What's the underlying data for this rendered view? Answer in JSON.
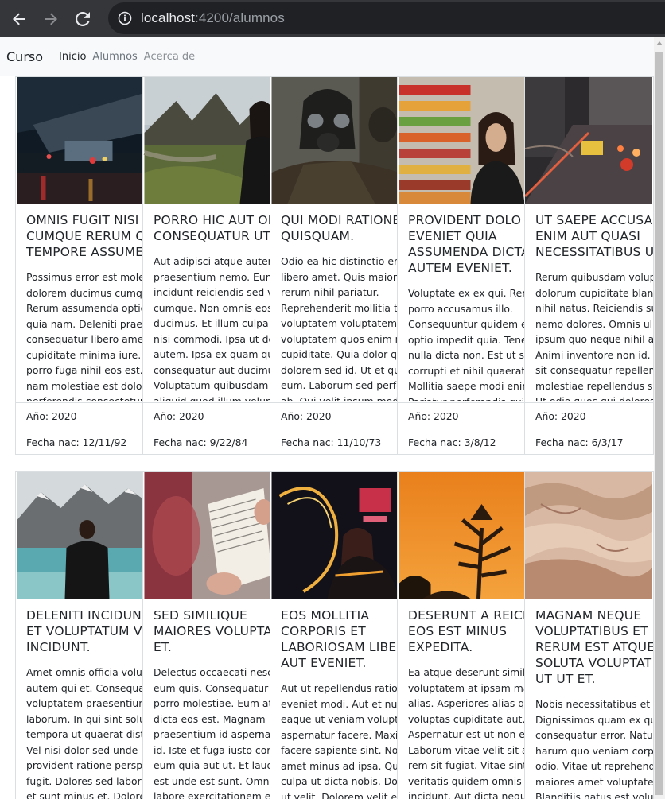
{
  "browser": {
    "url_host": "localhost",
    "url_path": ":4200/alumnos",
    "icons": {
      "back": "arrow-left-icon",
      "forward": "arrow-right-icon",
      "reload": "reload-icon",
      "site_info": "info-icon"
    }
  },
  "navbar": {
    "brand": "Curso",
    "links": [
      "Inicio",
      "Alumnos",
      "Acerca de"
    ]
  },
  "cards": [
    {
      "title": "OMNIS FUGIT NISI R\nCUMQUE RERUM Q\nTEMPORE ASSUME",
      "text": "Possimus error est mole\ndolorem ducimus cumqu\nRerum assumenda optio\nquia nam. Deleniti praes\nconsequatur libero amet\ncupiditate minima iure. C\nporro fuga nihil eos est.\nnam molestiae est dolor\nperferendis consectetur",
      "year": "Año: 2020",
      "date": "Fecha nac: 12/11/92"
    },
    {
      "title": "PORRO HIC AUT OI\nCONSEQUATUR UT",
      "text": "Aut adipisci atque autem\npraesentium nemo. Eum\nincidunt reiciendis sed v\ncumque. Non omnis eos\nducimus. Et illum culpa f\nnisi commodi. Ipsa ut de\nautem. Ipsa ex quam qui\nconsequatur aut ducimu\nVoluptatum quibusdam\naliquid quod illum volup",
      "year": "Año: 2020",
      "date": "Fecha nac: 9/22/84"
    },
    {
      "title": "QUI MODI RATIONE\nQUISQUAM.",
      "text": "Odio ea hic distinctio err\nlibero amet. Quis maiore\nrerum nihil pariatur.\nReprehenderit mollitia t\nvoluptatem voluptatem.\nvoluptatem quos enim re\ncupiditate. Quia dolor qu\ndolorem sed id. Ut et qu\neum. Laborum sed perfe\nab. Qui velit ipsum modi",
      "year": "Año: 2020",
      "date": "Fecha nac: 11/10/73"
    },
    {
      "title": "PROVIDENT DOLO\nEVENIET QUIA\nASSUMENDA DICTA\nAUTEM EVENIET.",
      "text": "Voluptate ex ex qui. Rer\nporro accusamus illo.\nConsequuntur quidem e\noptio impedit quia. Tene\nnulla dicta non. Est ut se\ncorrupti et nihil quaerat.\nMollitia saepe modi enin\nPariatur perferendis qui",
      "year": "Año: 2020",
      "date": "Fecha nac: 3/8/12"
    },
    {
      "title": "UT SAEPE ACCUSAM\nENIM AUT QUASI\nNECESSITATIBUS UT",
      "text": "Rerum quibusdam volup\ndolorum cupiditate blan\nnihil natus. Reiciendis su\nnemo dolores. Omnis ull\nipsum quo neque nihil ab\nAnimi inventore non id. L\nsit consequatur repellen\nmolestiae repellendus si\nUt odio quos qui dolores",
      "year": "Año: 2020",
      "date": "Fecha nac: 6/3/17"
    },
    {
      "title": "DELENITI INCIDUN\nET VOLUPTATUM V\nINCIDUNT.",
      "text": "Amet omnis officia volup\nautem qui et. Consequat\nvoluptatem praesentium\nlaborum. In qui sint solut\ntempora ut quaerat disti\nVel nisi dolor sed unde\nprovident ratione perspi\nfugit. Dolores sed labori\net sunt minus et. Dolore",
      "year": "",
      "date": ""
    },
    {
      "title": "SED SIMILIQUE\nMAIORES VOLUPTA\nET.",
      "text": "Delectus occaecati nesci\neum quis. Consequatur i\nporro molestiae. Eum at\ndicta eos est. Magnam\npraesentium id aspernat\nid. Iste et fuga iusto corr\neum quia aut ut. Et lauda\nest unde est sunt. Omnis\nlabore exercitationem e",
      "year": "",
      "date": ""
    },
    {
      "title": "EOS MOLLITIA\nCORPORIS ET\nLABORIOSAM LIBE\nAUT EVENIET.",
      "text": "Aut ut repellendus ratio\neveniet modi. Aut et nun\neaque ut veniam volupta\naspernatur facere. Maxin\nfacere sapiente sint. Nor\namet minus ad ipsa. Qui\nculpa ut dicta nobis. Dol\nut velit. Dolorem velit eu",
      "year": "",
      "date": ""
    },
    {
      "title": "DESERUNT A REICI\nEOS EST MINUS\nEXPEDITA.",
      "text": "Ea atque deserunt simili\nvoluptatem at ipsam ma\nalias. Asperiores alias qu\nvoluptas cupiditate aut.\nAspernatur est ut non ec\nLaborum vitae velit sit a\nrem sit fugiat. Vitae sint\nveritatis quidem omnis u\nincidunt. Aut dicta neque",
      "year": "",
      "date": ""
    },
    {
      "title": "MAGNAM NEQUE\nVOLUPTATIBUS ET\nRERUM EST ATQUE\nSOLUTA VOLUPTAT\nUT UT ET.",
      "text": "Nobis necessitatibus et e\nDignissimos quam ex qui\nconsequatur error. Natus\nharum quo veniam corpo\nodio. Vitae ut reprehend\nmaiores amet voluptater\nBlanditiis natus est volup",
      "year": "",
      "date": ""
    }
  ]
}
